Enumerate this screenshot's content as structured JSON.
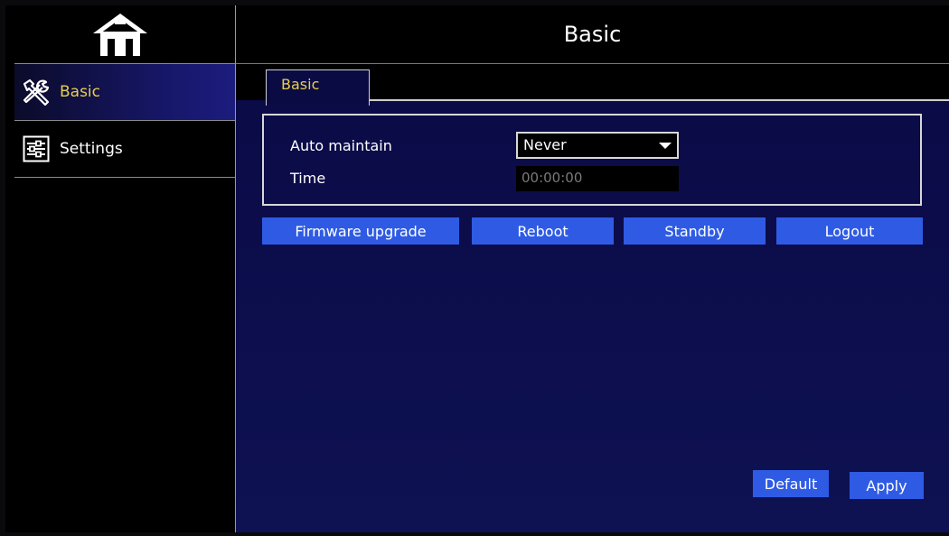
{
  "sidebar": {
    "items": [
      {
        "label": "Basic",
        "icon": "tools-icon",
        "active": true
      },
      {
        "label": "Settings",
        "icon": "sliders-icon",
        "active": false
      }
    ]
  },
  "header": {
    "title": "Basic"
  },
  "tabs": [
    {
      "label": "Basic",
      "active": true
    }
  ],
  "form": {
    "auto_maintain_label": "Auto maintain",
    "auto_maintain_value": "Never",
    "time_label": "Time",
    "time_value": "00:00:00"
  },
  "actions": {
    "firmware_label": "Firmware upgrade",
    "reboot_label": "Reboot",
    "standby_label": "Standby",
    "logout_label": "Logout"
  },
  "footer": {
    "default_label": "Default",
    "apply_label": "Apply"
  },
  "colors": {
    "accent_yellow": "#e7d04a",
    "button_blue": "#2f5be4",
    "panel_navy": "#0a0a46"
  }
}
